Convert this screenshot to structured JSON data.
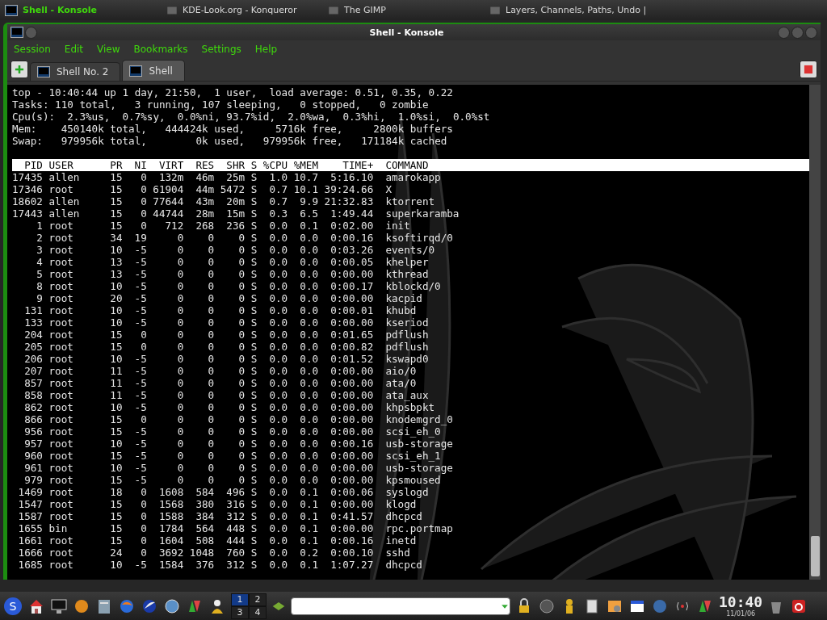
{
  "taskbar": {
    "tasks": [
      {
        "label": "Shell - Konsole",
        "selected": true
      },
      {
        "label": "KDE-Look.org - Konqueror",
        "selected": false
      },
      {
        "label": "The GIMP",
        "selected": false
      },
      {
        "label": "Layers, Channels, Paths, Undo |",
        "selected": false
      }
    ]
  },
  "window": {
    "title": "Shell - Konsole",
    "menu": [
      "Session",
      "Edit",
      "View",
      "Bookmarks",
      "Settings",
      "Help"
    ],
    "tabs": [
      {
        "label": "Shell No. 2",
        "selected": false
      },
      {
        "label": "Shell",
        "selected": true
      }
    ]
  },
  "terminal": {
    "summary": [
      "top - 10:40:44 up 1 day, 21:50,  1 user,  load average: 0.51, 0.35, 0.22",
      "Tasks: 110 total,   3 running, 107 sleeping,   0 stopped,   0 zombie",
      "Cpu(s):  2.3%us,  0.7%sy,  0.0%ni, 93.7%id,  2.0%wa,  0.3%hi,  1.0%si,  0.0%st",
      "Mem:    450140k total,   444424k used,     5716k free,     2800k buffers",
      "Swap:   979956k total,        0k used,   979956k free,   171184k cached"
    ],
    "columns": [
      "PID",
      "USER",
      "PR",
      "NI",
      "VIRT",
      "RES",
      "SHR",
      "S",
      "%CPU",
      "%MEM",
      "TIME+",
      "COMMAND"
    ],
    "processes": [
      [
        "17435",
        "allen",
        "15",
        "0",
        "132m",
        "46m",
        "25m",
        "S",
        "1.0",
        "10.7",
        "5:16.10",
        "amarokapp"
      ],
      [
        "17346",
        "root",
        "15",
        "0",
        "61904",
        "44m",
        "5472",
        "S",
        "0.7",
        "10.1",
        "39:24.66",
        "X"
      ],
      [
        "18602",
        "allen",
        "15",
        "0",
        "77644",
        "43m",
        "20m",
        "S",
        "0.7",
        "9.9",
        "21:32.83",
        "ktorrent"
      ],
      [
        "17443",
        "allen",
        "15",
        "0",
        "44744",
        "28m",
        "15m",
        "S",
        "0.3",
        "6.5",
        "1:49.44",
        "superkaramba"
      ],
      [
        "1",
        "root",
        "15",
        "0",
        "712",
        "268",
        "236",
        "S",
        "0.0",
        "0.1",
        "0:02.00",
        "init"
      ],
      [
        "2",
        "root",
        "34",
        "19",
        "0",
        "0",
        "0",
        "S",
        "0.0",
        "0.0",
        "0:00.16",
        "ksoftirqd/0"
      ],
      [
        "3",
        "root",
        "10",
        "-5",
        "0",
        "0",
        "0",
        "S",
        "0.0",
        "0.0",
        "0:03.26",
        "events/0"
      ],
      [
        "4",
        "root",
        "13",
        "-5",
        "0",
        "0",
        "0",
        "S",
        "0.0",
        "0.0",
        "0:00.05",
        "khelper"
      ],
      [
        "5",
        "root",
        "13",
        "-5",
        "0",
        "0",
        "0",
        "S",
        "0.0",
        "0.0",
        "0:00.00",
        "kthread"
      ],
      [
        "8",
        "root",
        "10",
        "-5",
        "0",
        "0",
        "0",
        "S",
        "0.0",
        "0.0",
        "0:00.17",
        "kblockd/0"
      ],
      [
        "9",
        "root",
        "20",
        "-5",
        "0",
        "0",
        "0",
        "S",
        "0.0",
        "0.0",
        "0:00.00",
        "kacpid"
      ],
      [
        "131",
        "root",
        "10",
        "-5",
        "0",
        "0",
        "0",
        "S",
        "0.0",
        "0.0",
        "0:00.01",
        "khubd"
      ],
      [
        "133",
        "root",
        "10",
        "-5",
        "0",
        "0",
        "0",
        "S",
        "0.0",
        "0.0",
        "0:00.00",
        "kseriod"
      ],
      [
        "204",
        "root",
        "15",
        "0",
        "0",
        "0",
        "0",
        "S",
        "0.0",
        "0.0",
        "0:01.65",
        "pdflush"
      ],
      [
        "205",
        "root",
        "15",
        "0",
        "0",
        "0",
        "0",
        "S",
        "0.0",
        "0.0",
        "0:00.82",
        "pdflush"
      ],
      [
        "206",
        "root",
        "10",
        "-5",
        "0",
        "0",
        "0",
        "S",
        "0.0",
        "0.0",
        "0:01.52",
        "kswapd0"
      ],
      [
        "207",
        "root",
        "11",
        "-5",
        "0",
        "0",
        "0",
        "S",
        "0.0",
        "0.0",
        "0:00.00",
        "aio/0"
      ],
      [
        "857",
        "root",
        "11",
        "-5",
        "0",
        "0",
        "0",
        "S",
        "0.0",
        "0.0",
        "0:00.00",
        "ata/0"
      ],
      [
        "858",
        "root",
        "11",
        "-5",
        "0",
        "0",
        "0",
        "S",
        "0.0",
        "0.0",
        "0:00.00",
        "ata_aux"
      ],
      [
        "862",
        "root",
        "10",
        "-5",
        "0",
        "0",
        "0",
        "S",
        "0.0",
        "0.0",
        "0:00.00",
        "khpsbpkt"
      ],
      [
        "866",
        "root",
        "15",
        "0",
        "0",
        "0",
        "0",
        "S",
        "0.0",
        "0.0",
        "0:00.00",
        "knodemgrd_0"
      ],
      [
        "956",
        "root",
        "15",
        "-5",
        "0",
        "0",
        "0",
        "S",
        "0.0",
        "0.0",
        "0:00.00",
        "scsi_eh_0"
      ],
      [
        "957",
        "root",
        "10",
        "-5",
        "0",
        "0",
        "0",
        "S",
        "0.0",
        "0.0",
        "0:00.16",
        "usb-storage"
      ],
      [
        "960",
        "root",
        "15",
        "-5",
        "0",
        "0",
        "0",
        "S",
        "0.0",
        "0.0",
        "0:00.00",
        "scsi_eh_1"
      ],
      [
        "961",
        "root",
        "10",
        "-5",
        "0",
        "0",
        "0",
        "S",
        "0.0",
        "0.0",
        "0:00.00",
        "usb-storage"
      ],
      [
        "979",
        "root",
        "15",
        "-5",
        "0",
        "0",
        "0",
        "S",
        "0.0",
        "0.0",
        "0:00.00",
        "kpsmoused"
      ],
      [
        "1469",
        "root",
        "18",
        "0",
        "1608",
        "584",
        "496",
        "S",
        "0.0",
        "0.1",
        "0:00.06",
        "syslogd"
      ],
      [
        "1547",
        "root",
        "15",
        "0",
        "1568",
        "380",
        "316",
        "S",
        "0.0",
        "0.1",
        "0:00.00",
        "klogd"
      ],
      [
        "1587",
        "root",
        "15",
        "0",
        "1588",
        "384",
        "312",
        "S",
        "0.0",
        "0.1",
        "0:41.57",
        "dhcpcd"
      ],
      [
        "1655",
        "bin",
        "15",
        "0",
        "1784",
        "564",
        "448",
        "S",
        "0.0",
        "0.1",
        "0:00.00",
        "rpc.portmap"
      ],
      [
        "1661",
        "root",
        "15",
        "0",
        "1604",
        "508",
        "444",
        "S",
        "0.0",
        "0.1",
        "0:00.16",
        "inetd"
      ],
      [
        "1666",
        "root",
        "24",
        "0",
        "3692",
        "1048",
        "760",
        "S",
        "0.0",
        "0.2",
        "0:00.10",
        "sshd"
      ],
      [
        "1685",
        "root",
        "10",
        "-5",
        "1584",
        "376",
        "312",
        "S",
        "0.0",
        "0.1",
        "1:07.27",
        "dhcpcd"
      ]
    ]
  },
  "panel": {
    "start_label": "S",
    "pager": [
      {
        "label": "1",
        "selected": true
      },
      {
        "label": "2",
        "selected": false
      },
      {
        "label": "3",
        "selected": false
      },
      {
        "label": "4",
        "selected": false
      }
    ],
    "clock": "10:40",
    "date": "11/01/06"
  }
}
